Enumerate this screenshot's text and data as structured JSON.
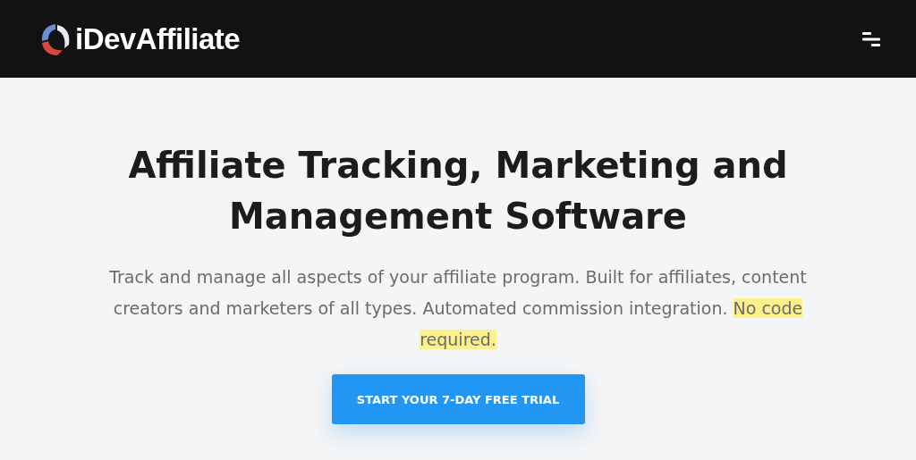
{
  "header": {
    "logo": "iDevAffiliate"
  },
  "hero": {
    "title": "Affiliate Tracking, Marketing and Management Software",
    "description": "Track and manage all aspects of your affiliate program. Built for affiliates, content creators and marketers of all types. Automated commission integration.",
    "highlight": "No code required.",
    "button": "START YOUR 7-DAY FREE TRIAL"
  }
}
